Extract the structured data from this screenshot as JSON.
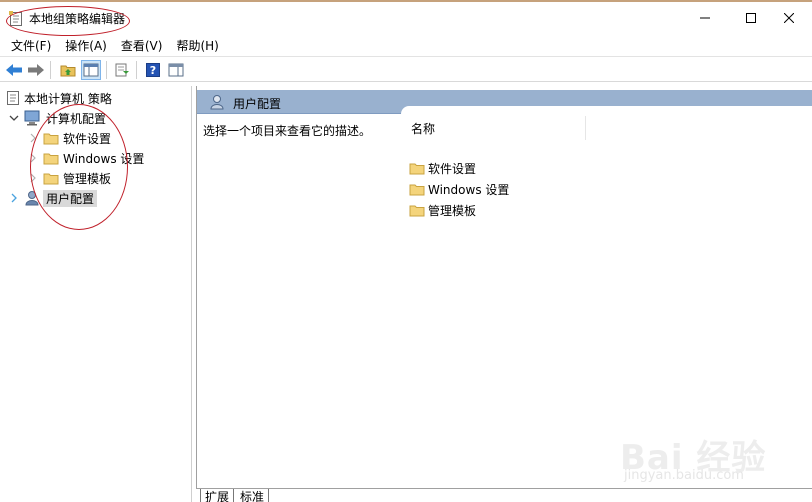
{
  "window": {
    "title": "本地组策略编辑器",
    "controls": {
      "minimize": "–",
      "maximize": "☐",
      "close": "✕"
    }
  },
  "menu": [
    "文件(F)",
    "操作(A)",
    "查看(V)",
    "帮助(H)"
  ],
  "toolbar": {
    "buttons": [
      "back-icon",
      "forward-icon",
      "up-folder-icon",
      "show-tree-icon",
      "export-list-icon",
      "help-icon",
      "show-action-pane-icon"
    ]
  },
  "tree": {
    "root": "本地计算机 策略",
    "computer_config": "计算机配置",
    "software_settings": "软件设置",
    "windows_settings": "Windows 设置",
    "admin_templates": "管理模板",
    "user_config": "用户配置"
  },
  "right": {
    "header": "用户配置",
    "description": "选择一个项目来查看它的描述。",
    "column_name": "名称",
    "items": [
      "软件设置",
      "Windows 设置",
      "管理模板"
    ]
  },
  "tabs": [
    "扩展",
    "标准"
  ],
  "watermark": {
    "brand": "Bai 经验",
    "url": "jingyan.baidu.com"
  },
  "colors": {
    "header_bg": "#99b1cf",
    "annotation": "#c0202a",
    "folder": "#f4d47c"
  }
}
